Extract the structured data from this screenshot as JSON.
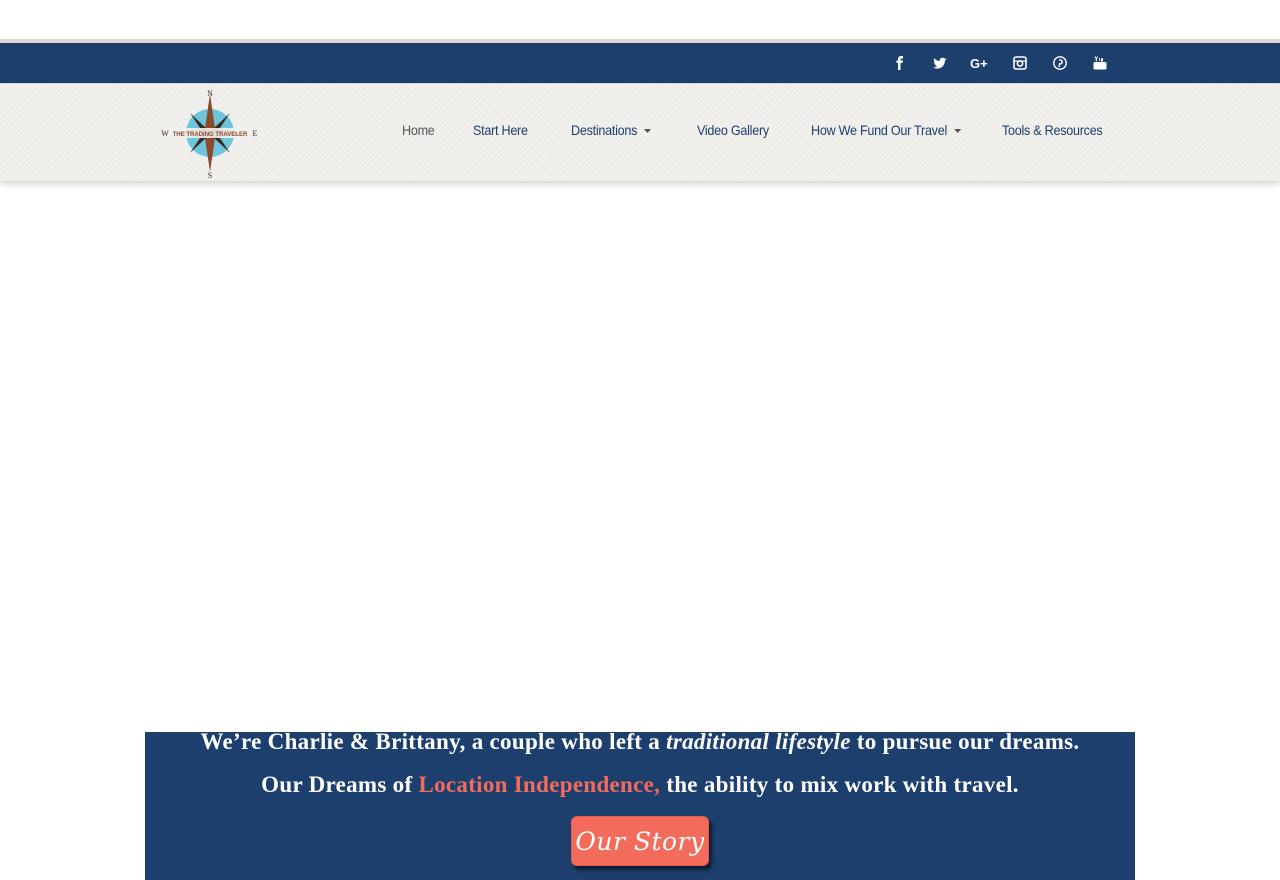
{
  "social": {
    "icons": [
      "facebook-icon",
      "twitter-icon",
      "google-plus-icon",
      "instagram-icon",
      "pinterest-icon",
      "youtube-icon"
    ]
  },
  "logo": {
    "text": "THE TRADING TRAVELER",
    "directions": [
      "N",
      "E",
      "S",
      "W"
    ]
  },
  "nav": {
    "items": [
      {
        "label": "Home",
        "dropdown": false
      },
      {
        "label": "Start Here",
        "dropdown": false
      },
      {
        "label": "Destinations",
        "dropdown": true
      },
      {
        "label": "Video Gallery",
        "dropdown": false
      },
      {
        "label": "How We Fund Our Travel",
        "dropdown": true
      },
      {
        "label": "Tools & Resources",
        "dropdown": false
      }
    ]
  },
  "banner": {
    "line1_a": "We’re Charlie & Brittany, a couple who left a ",
    "line1_em": "traditional lifestyle",
    "line1_b": " to pursue our dreams.",
    "line2_a": "Our Dreams of ",
    "line2_highlight": "Location Independence,",
    "line2_b": " the ability to mix work with travel.",
    "button_label": "Our Story"
  },
  "colors": {
    "navy": "#1c3f6e",
    "coral": "#f26b5b",
    "nav_bg": "#f3f1ee"
  }
}
